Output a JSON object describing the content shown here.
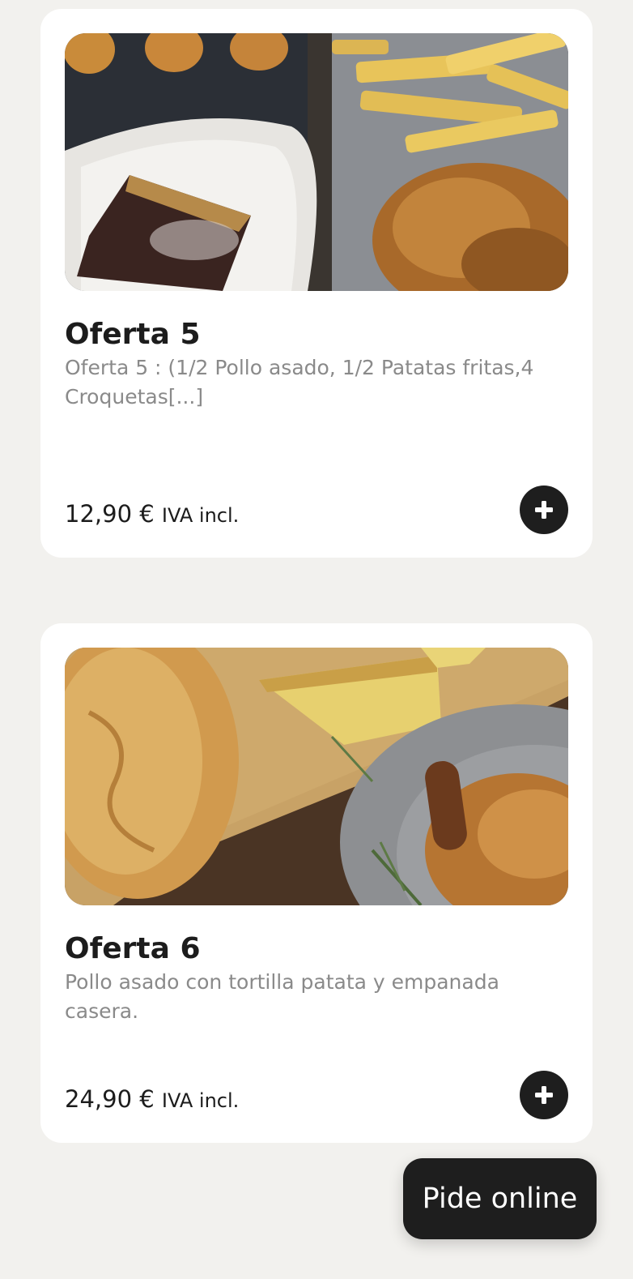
{
  "products": [
    {
      "title": "Oferta 5",
      "description": "Oferta 5 : (1/2 Pollo asado, 1/2 Patatas fritas,4 Croquetas[...]",
      "price": "12,90 €",
      "tax_note": "IVA incl.",
      "image_alt": "Pollo asado, patatas fritas, croquetas y tarta de chocolate",
      "add_icon": "plus-icon"
    },
    {
      "title": "Oferta 6",
      "description": "Pollo asado con tortilla patata y empanada casera.",
      "price": "24,90 €",
      "tax_note": "IVA incl.",
      "image_alt": "Pollo asado, tortilla de patata y empanada casera",
      "add_icon": "plus-icon"
    }
  ],
  "cta": {
    "label": "Pide online"
  },
  "colors": {
    "background": "#f2f1ee",
    "card": "#ffffff",
    "button": "#1e1e1e",
    "title_text": "#1c1c1c",
    "description_text": "#8a8a8a"
  }
}
